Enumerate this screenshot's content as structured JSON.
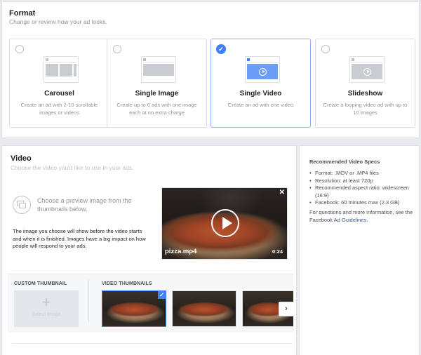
{
  "format": {
    "title": "Format",
    "subtitle": "Change or review how your ad looks.",
    "options": [
      {
        "label": "Carousel",
        "description": "Create an ad with 2-10 scrollable images or videos",
        "selected": false
      },
      {
        "label": "Single Image",
        "description": "Create up to 6 ads with one image each at no extra charge",
        "selected": false
      },
      {
        "label": "Single Video",
        "description": "Create an ad with one video",
        "selected": true
      },
      {
        "label": "Slideshow",
        "description": "Create a looping video ad with up to 10 images",
        "selected": false
      }
    ]
  },
  "video": {
    "title": "Video",
    "subtitle": "Choose the video you'd like to use in your ads.",
    "choose_prompt": "Choose a preview image from the thumbnails below.",
    "explanation": "The image you choose will show before the video starts and when it is finished. Images have a big impact on how people will respond to your ads.",
    "preview": {
      "filename": "pizza.mp4",
      "duration": "0:24",
      "close_glyph": "✕"
    },
    "thumbnails": {
      "custom_label": "CUSTOM THUMBNAIL",
      "select_image_label": "Select Image",
      "plus_glyph": "+",
      "video_label": "VIDEO THUMBNAILS",
      "selected_index": 0,
      "check_glyph": "✓",
      "next_glyph": "›"
    }
  },
  "specs": {
    "title": "Recommended Video Specs",
    "items": [
      "Format: .MOV or .MP4 files",
      "Resolution: at least 720p",
      "Recommended aspect ratio: widescreen (16:9)",
      "Facebook: 60 minutes max (2.3 GB)"
    ],
    "more_prefix": "For questions and more information, see the Facebook ",
    "link_text": "Ad Guidelines",
    "more_suffix": "."
  },
  "colors": {
    "accent": "#4080ff",
    "selected_border": "#8cb0f2",
    "link": "#365899"
  }
}
